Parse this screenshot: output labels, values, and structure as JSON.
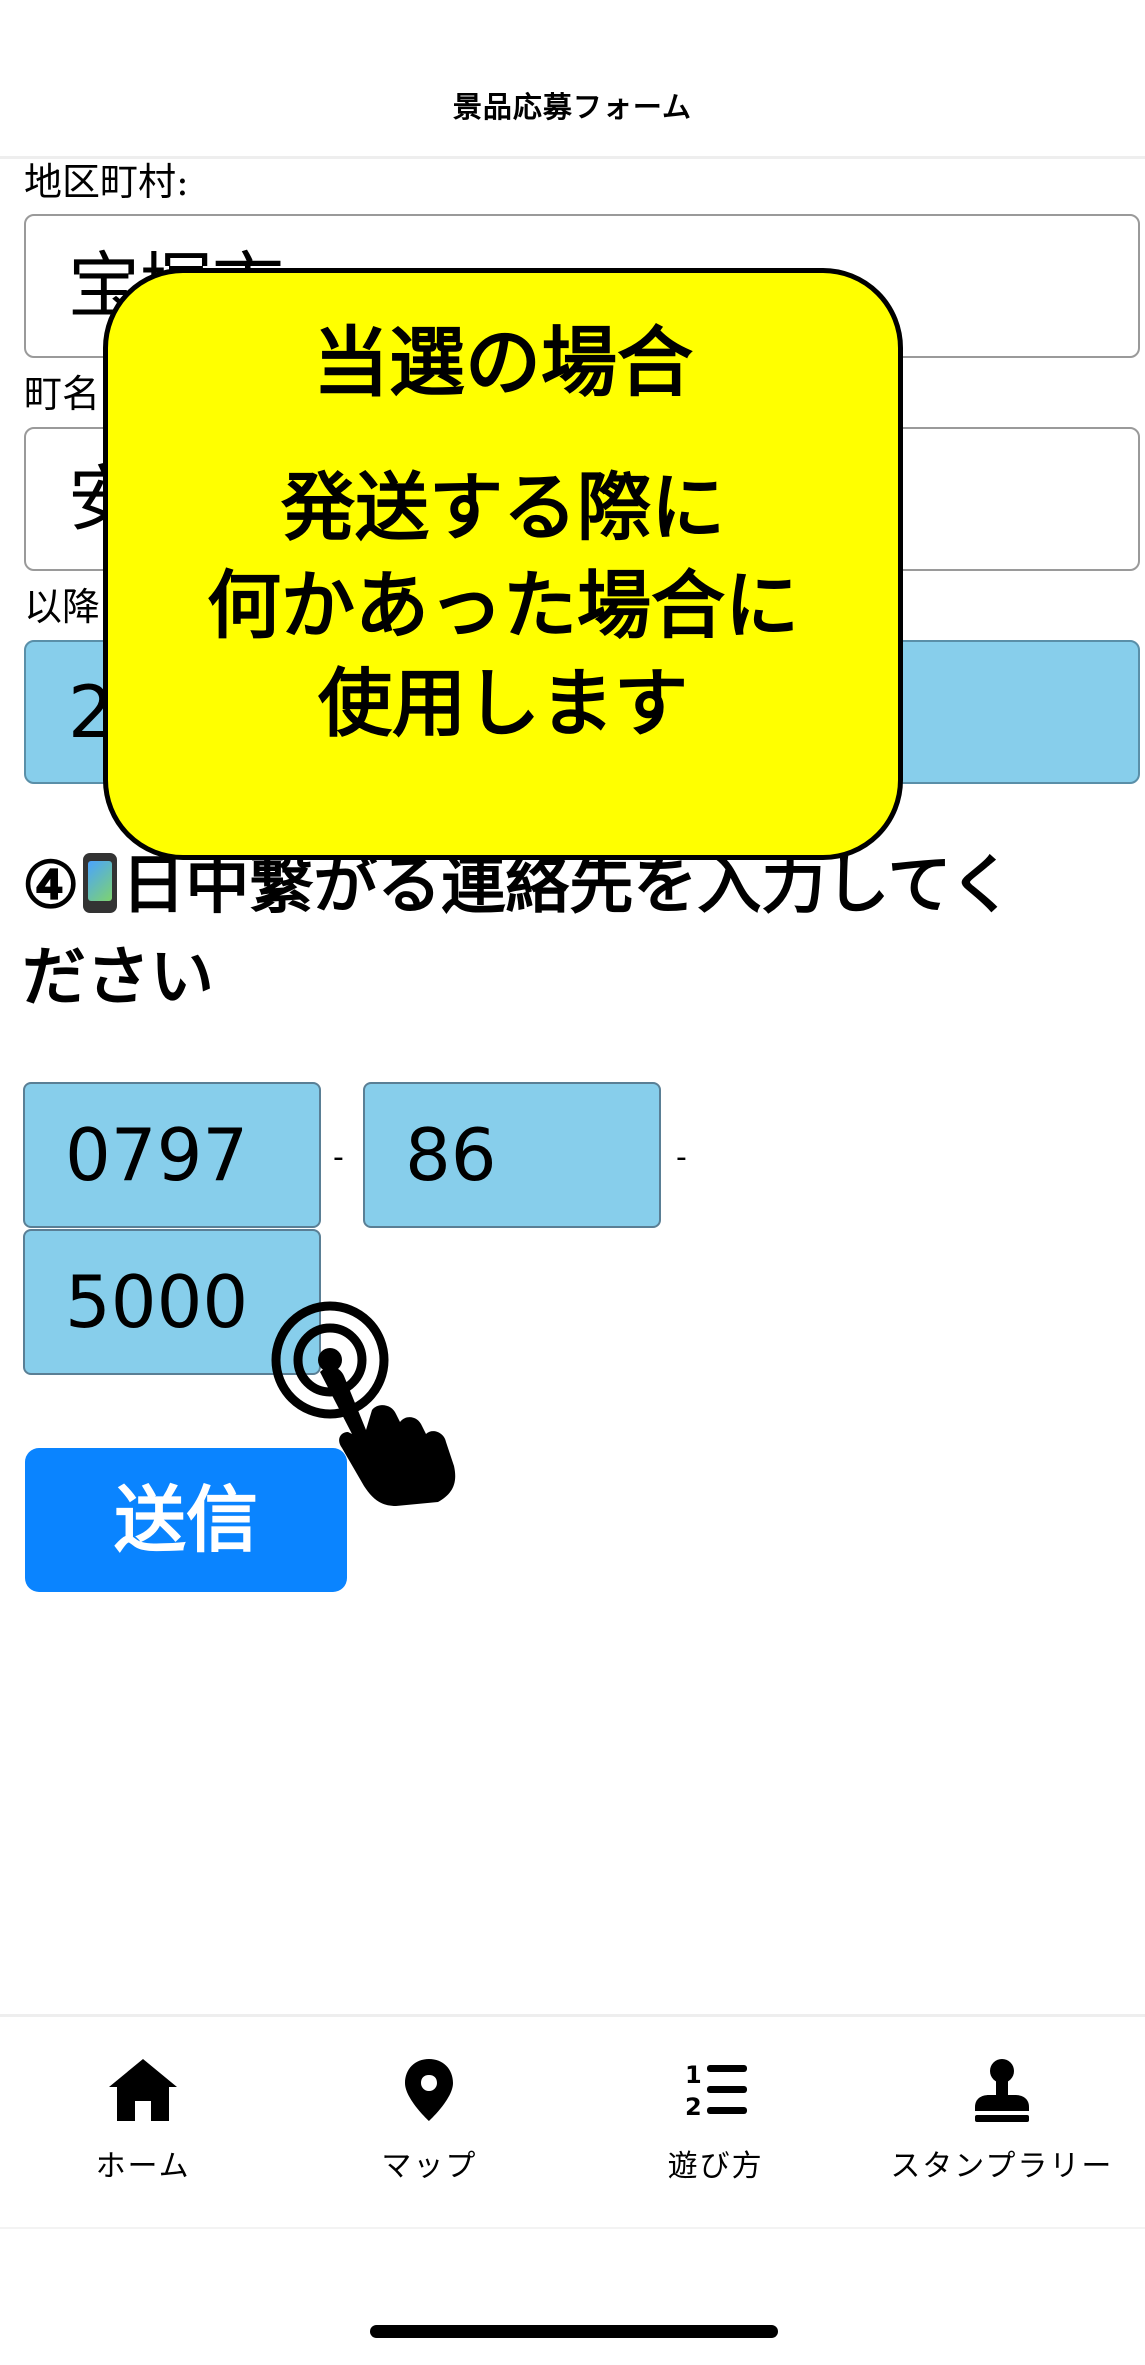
{
  "header": {
    "title": "景品応募フォーム"
  },
  "form": {
    "district_label": "地区町村:",
    "district_value": "宝塚市",
    "town_label": "町名",
    "town_value": "安",
    "rest_label": "以降",
    "rest_value": "2",
    "question_number": "④",
    "question_text": "日中繋がる連絡先を入力してください",
    "phone_icon": "mobile-phone-icon",
    "tel_part1": "0797",
    "tel_part2": "86",
    "tel_part3": "5000",
    "tel_separator": "-",
    "submit_label": "送信"
  },
  "popup": {
    "title": "当選の場合",
    "line1": "発送する際に",
    "line2": "何かあった場合に",
    "line3": "使用します",
    "colors": {
      "background": "#ffff00",
      "border": "#000000"
    }
  },
  "tap_hint": {
    "icon": "tap-hand-icon"
  },
  "tabbar": {
    "items": [
      {
        "label": "ホーム",
        "icon": "home-icon"
      },
      {
        "label": "マップ",
        "icon": "map-pin-icon"
      },
      {
        "label": "遊び方",
        "icon": "numbered-list-icon"
      },
      {
        "label": "スタンプラリー",
        "icon": "stamp-icon"
      }
    ]
  },
  "colors": {
    "input_filled": "#87ceeb",
    "submit_button": "#0a84ff"
  }
}
